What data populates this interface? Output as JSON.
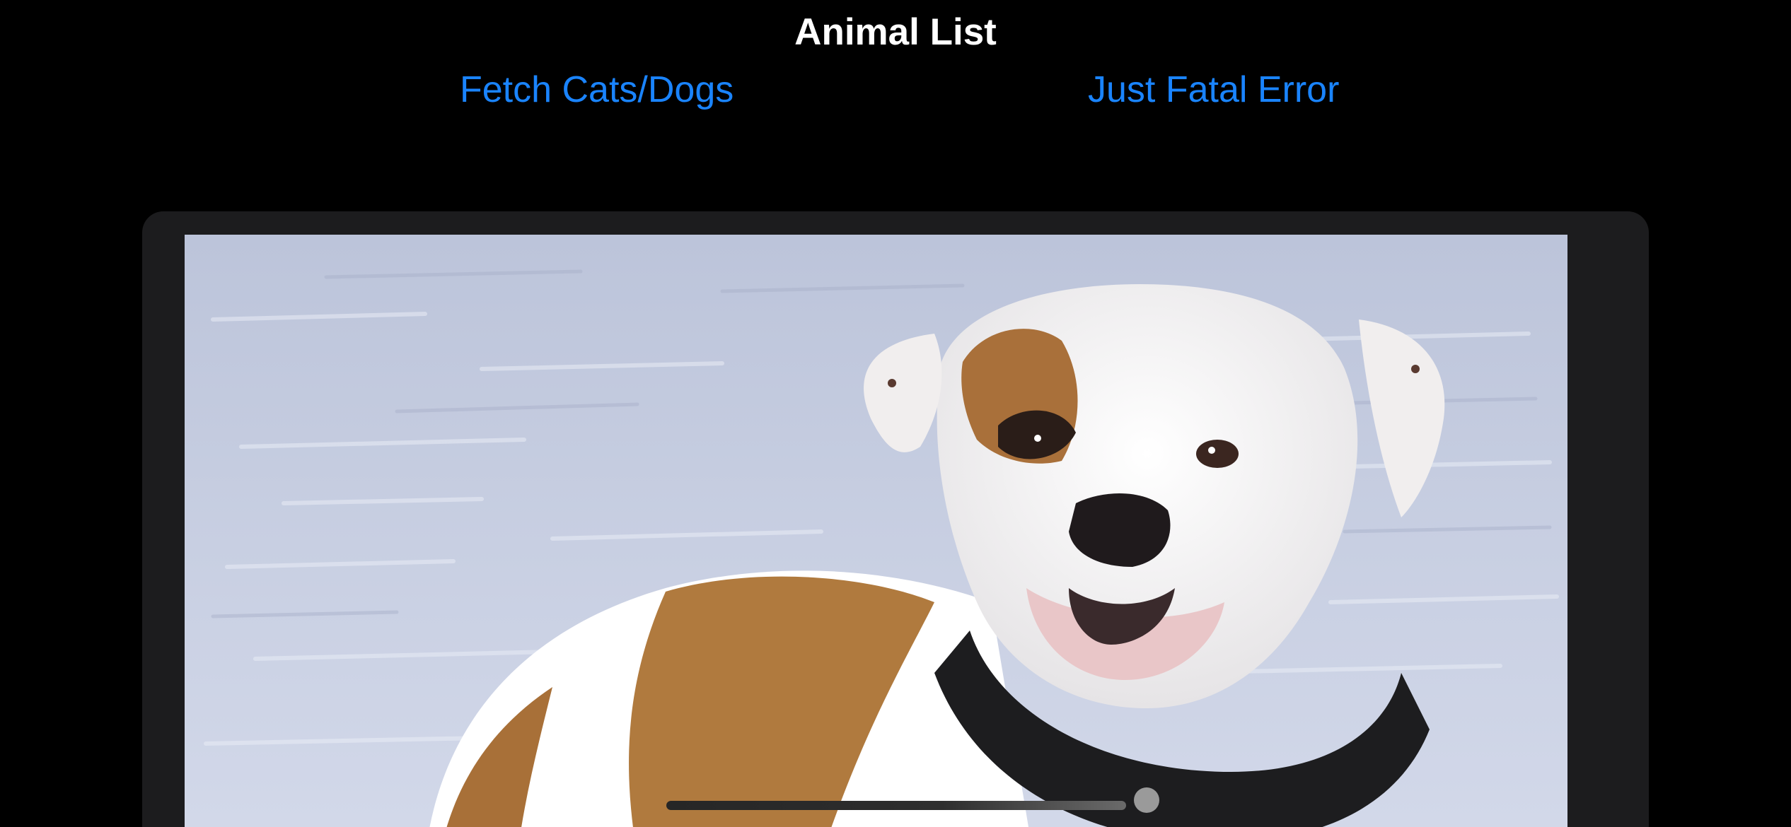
{
  "header": {
    "title": "Animal List"
  },
  "toolbar": {
    "fetch_label": "Fetch Cats/Dogs",
    "fatal_label": "Just Fatal Error"
  },
  "list": {
    "items": [
      {
        "image_subject": "white-and-brown-dog-photo"
      }
    ]
  },
  "colors": {
    "background": "#000000",
    "card": "#1c1c1e",
    "accent": "#1a84ff",
    "title": "#ffffff"
  }
}
